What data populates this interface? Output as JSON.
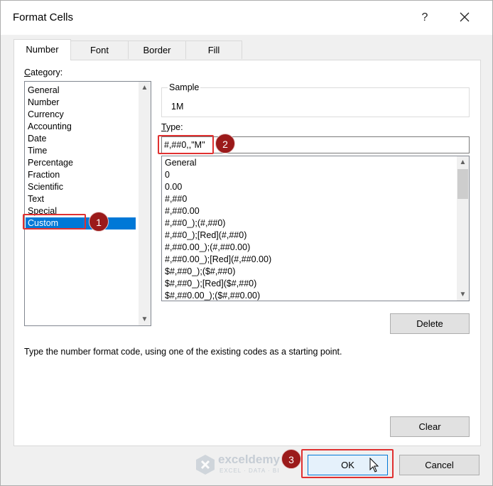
{
  "dialog": {
    "title": "Format Cells",
    "help_label": "?",
    "close_icon": "close-icon"
  },
  "tabs": [
    {
      "label": "Number",
      "active": true
    },
    {
      "label": "Font",
      "active": false
    },
    {
      "label": "Border",
      "active": false
    },
    {
      "label": "Fill",
      "active": false
    }
  ],
  "category": {
    "label": "Category:",
    "items": [
      "General",
      "Number",
      "Currency",
      "Accounting",
      "Date",
      "Time",
      "Percentage",
      "Fraction",
      "Scientific",
      "Text",
      "Special",
      "Custom"
    ],
    "selected": "Custom"
  },
  "sample": {
    "label": "Sample",
    "value": "1M"
  },
  "type": {
    "label": "Type:",
    "value": "#,##0,,\"M\""
  },
  "formats": {
    "items": [
      "General",
      "0",
      "0.00",
      "#,##0",
      "#,##0.00",
      "#,##0_);(#,##0)",
      "#,##0_);[Red](#,##0)",
      "#,##0.00_);(#,##0.00)",
      "#,##0.00_);[Red](#,##0.00)",
      "$#,##0_);($#,##0)",
      "$#,##0_);[Red]($#,##0)",
      "$#,##0.00_);($#,##0.00)"
    ]
  },
  "buttons": {
    "delete": "Delete",
    "clear": "Clear",
    "ok": "OK",
    "cancel": "Cancel"
  },
  "description": "Type the number format code, using one of the existing codes as a starting point.",
  "annotations": {
    "step1": "1",
    "step2": "2",
    "step3": "3",
    "highlight_color": "#e03030",
    "badge_color": "#9b1a1a"
  },
  "watermark": {
    "name": "exceldemy",
    "tagline": "EXCEL · DATA · BI"
  },
  "colors": {
    "selection": "#0078d7",
    "ok_border": "#0078d7"
  }
}
